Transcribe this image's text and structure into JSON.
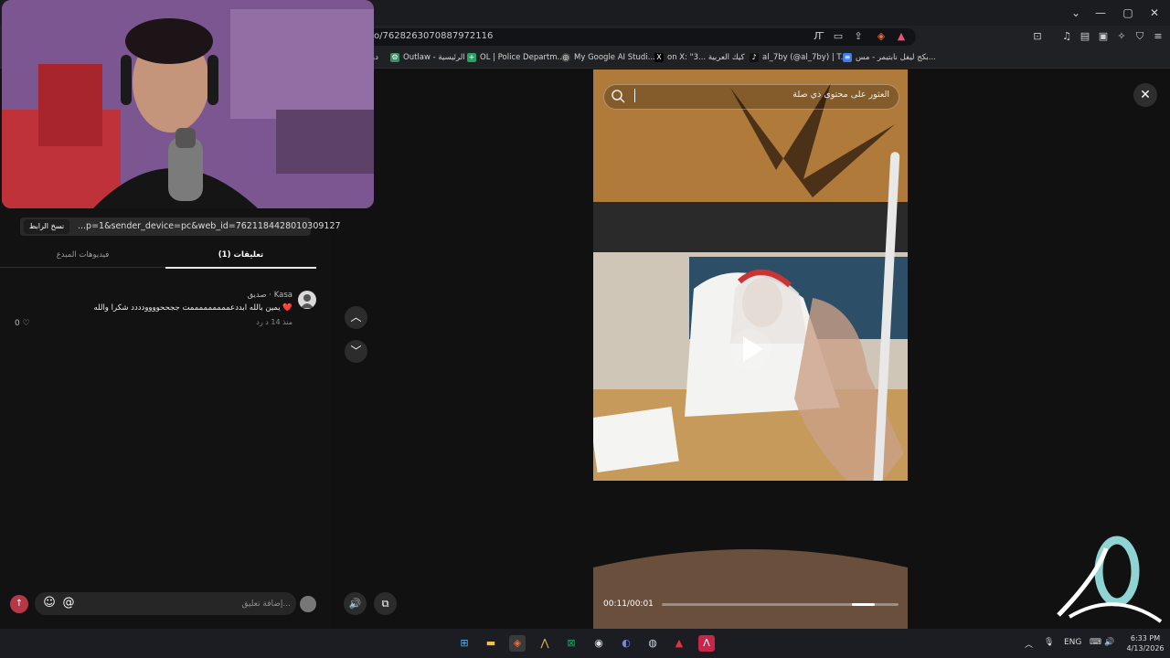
{
  "browser": {
    "url": "o/7628263070887972116",
    "bookmarks": [
      {
        "label": "دو",
        "icon": "cut-off-bookmark",
        "color": "#555"
      },
      {
        "label": "Outlaw - الرئيسية",
        "icon": "outlaw-favicon",
        "color": "#3a8f6a"
      },
      {
        "label": "OL | Police Departm...",
        "icon": "sheets-favicon",
        "color": "#21a464"
      },
      {
        "label": "My Google AI Studi...",
        "icon": "ai-studio-favicon",
        "color": "#444"
      },
      {
        "label": "on X: \"3... كيك العربية",
        "icon": "x-favicon",
        "color": "#000"
      },
      {
        "label": "al_7by (@al_7by) | T...",
        "icon": "tiktok-favicon",
        "color": "#111"
      },
      {
        "label": "بكج ليفل نابتيمر - مس...",
        "icon": "docs-favicon",
        "color": "#3b7ded"
      }
    ]
  },
  "share": {
    "copy_url": "...p=1&sender_device=pc&web_id=7621184428010309127",
    "copy_button": "نسخ الرابط"
  },
  "tabs": {
    "comments": "(1) تعليقات",
    "creator_videos": "فيديوهات المبدع"
  },
  "comment": {
    "author": "صديق · Kasa",
    "text": "يمين بالله ابددعمممممممممت ججححوووودددد شكرا والله ❤️",
    "meta": "منذ 14 د    رد",
    "likes": "0 ♡"
  },
  "composer": {
    "placeholder": "إضافة تعليق...",
    "mention": "@",
    "emoji": "☺"
  },
  "video": {
    "search_placeholder": "العثور على محتوى ذي صلة",
    "timecode": "00:11/00:01",
    "progress": 0.9
  },
  "taskbar": {
    "lang": "ENG",
    "time": "6:33 PM",
    "date": "4/13/2026"
  }
}
